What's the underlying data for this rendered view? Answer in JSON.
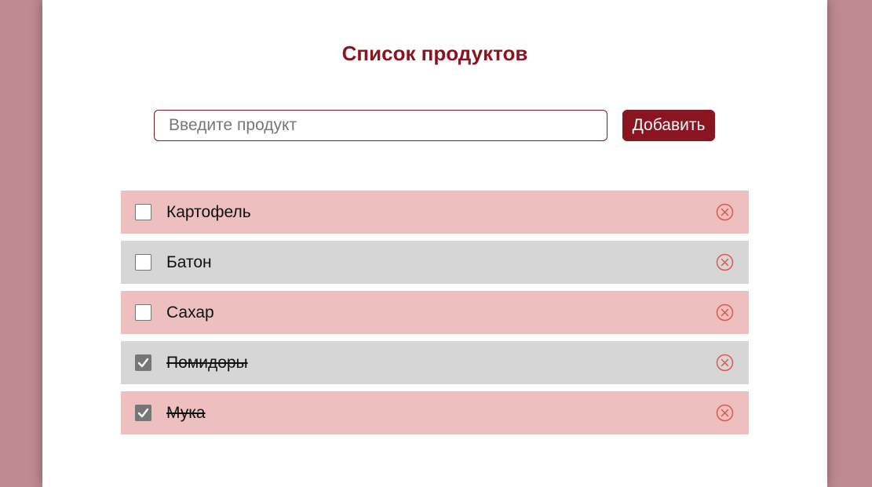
{
  "header": {
    "title": "Список продуктов"
  },
  "form": {
    "input_value": "",
    "input_placeholder": "Введите продукт",
    "add_label": "Добавить"
  },
  "products": [
    {
      "label": "Картофель",
      "checked": false
    },
    {
      "label": "Батон",
      "checked": false
    },
    {
      "label": "Сахар",
      "checked": false
    },
    {
      "label": "Помидоры",
      "checked": true
    },
    {
      "label": "Мука",
      "checked": true
    }
  ],
  "colors": {
    "accent": "#8b1421",
    "page_background": "#bf8a91",
    "row_odd": "#eebfbf",
    "row_even": "#d6d6d6",
    "delete_icon": "#e05555",
    "checkbox_checked": "#767676"
  },
  "icons": {
    "delete": "close-circle-icon",
    "check": "check-icon"
  }
}
